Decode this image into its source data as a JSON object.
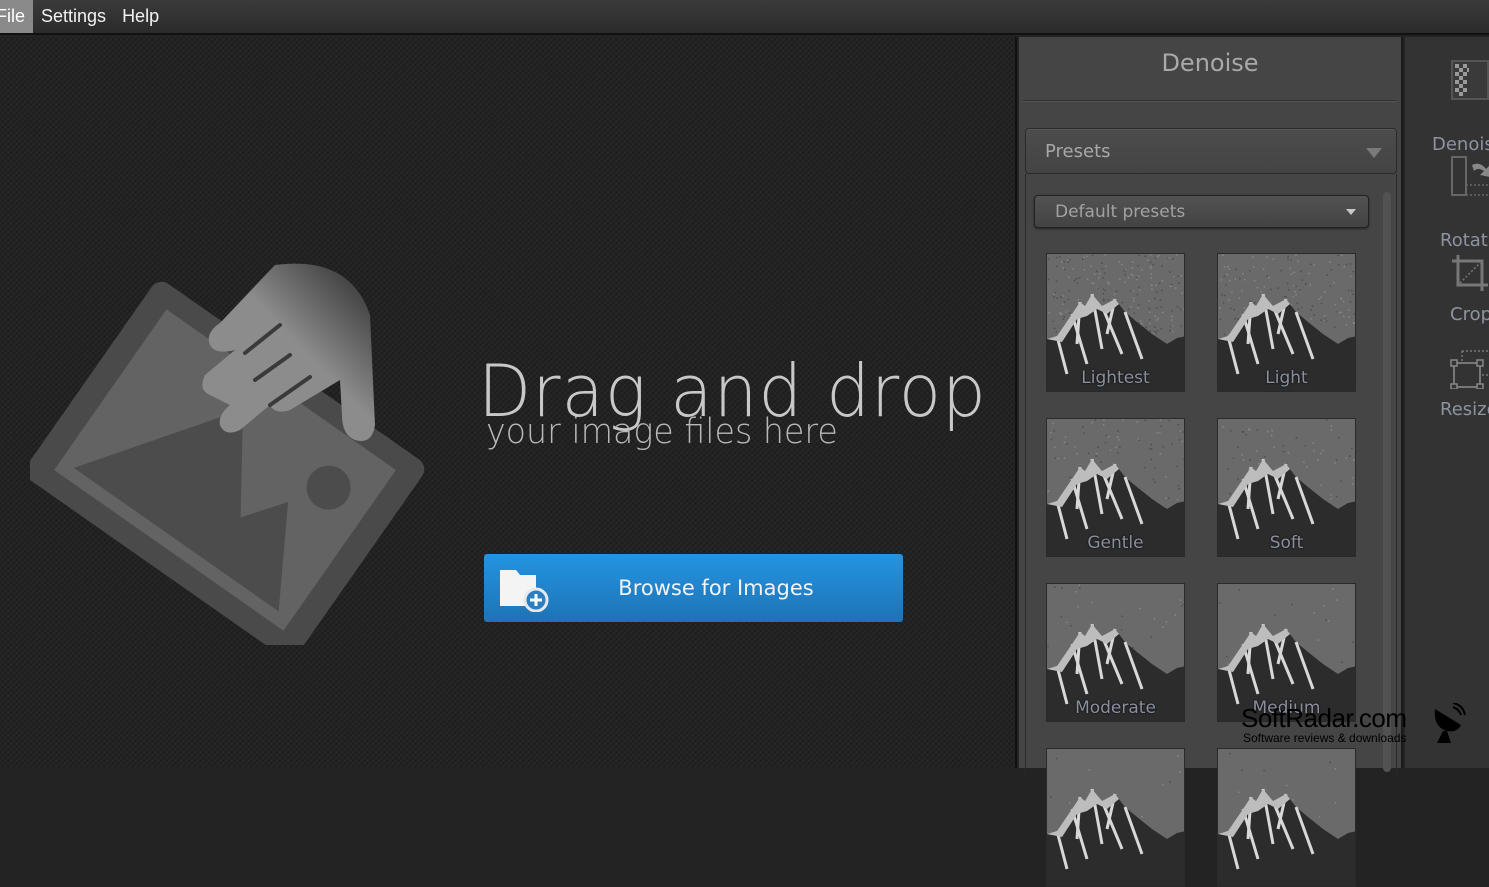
{
  "menubar": {
    "items": [
      {
        "label": "File",
        "active": true
      },
      {
        "label": "Settings",
        "active": false
      },
      {
        "label": "Help",
        "active": false
      }
    ]
  },
  "dropzone": {
    "title": "Drag and drop",
    "subtitle": "your image files here",
    "browse_button": {
      "label": "Browse for Images",
      "icon": "folder-add-icon"
    },
    "accent_color": "#1e88d8"
  },
  "panel": {
    "title": "Denoise",
    "presets_header": "Presets",
    "preset_dropdown": {
      "selected": "Default presets"
    },
    "presets": [
      {
        "label": "Lightest",
        "noise": 0.9
      },
      {
        "label": "Light",
        "noise": 0.6
      },
      {
        "label": "Gentle",
        "noise": 0.35
      },
      {
        "label": "Soft",
        "noise": 0.25
      },
      {
        "label": "Moderate",
        "noise": 0.12
      },
      {
        "label": "Medium",
        "noise": 0.08
      },
      {
        "label": "",
        "noise": 0.05
      },
      {
        "label": "",
        "noise": 0.04
      }
    ]
  },
  "toolbar": {
    "tools": [
      {
        "label": "Denoise",
        "icon": "denoise-icon"
      },
      {
        "label": "Rotate",
        "icon": "rotate-icon"
      },
      {
        "label": "Crop",
        "icon": "crop-icon"
      },
      {
        "label": "Resize",
        "icon": "resize-icon"
      }
    ]
  },
  "watermark": {
    "name": "SoftRadar.com",
    "tagline": "Software reviews & downloads"
  }
}
